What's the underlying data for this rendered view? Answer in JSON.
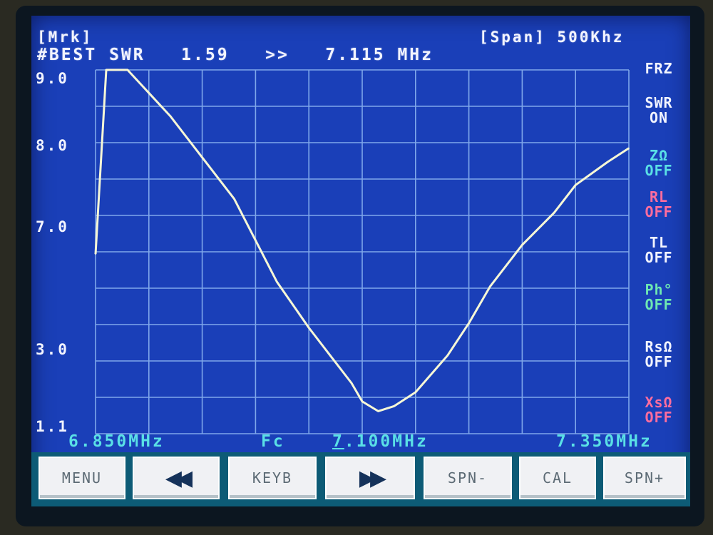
{
  "header": {
    "marker_label": "[Mrk]",
    "best_label": "#BEST SWR",
    "swr_value": "1.59",
    "arrows": ">>",
    "best_freq": "7.115 MHz",
    "span_label": "[Span] 500Khz"
  },
  "y_axis": {
    "ticks": [
      "9.0",
      "8.0",
      "7.0",
      "3.0",
      "1.1"
    ]
  },
  "side_menu": {
    "frz": "FRZ",
    "swr": [
      "SWR",
      "ON"
    ],
    "z": [
      "ZΩ",
      "OFF"
    ],
    "rl": [
      "RL",
      "OFF"
    ],
    "tl": [
      "TL",
      "OFF"
    ],
    "ph": [
      "Ph°",
      "OFF"
    ],
    "rs": [
      "RsΩ",
      "OFF"
    ],
    "xs": [
      "XsΩ",
      "OFF"
    ]
  },
  "freq_axis": {
    "start": "6.850MHz",
    "center_label": "Fc",
    "center_first_digit": "7",
    "center_rest": ".100MHz",
    "end": "7.350MHz"
  },
  "buttons": {
    "menu": "MENU",
    "back": "◀◀",
    "keyb": "KEYB",
    "fwd": "▶▶",
    "spn_minus": "SPN-",
    "cal": "CAL",
    "spn_plus": "SPN+"
  },
  "colors": {
    "screen_bg": "#1a3fb8",
    "grid": "#7fa7ea",
    "trace": "#f6f7d6",
    "cyan": "#5ae0e6",
    "magenta": "#ff6d9e",
    "green": "#6ee8b2"
  },
  "chart_data": {
    "type": "line",
    "x": [
      6.85,
      6.86,
      6.87,
      6.88,
      6.9,
      6.92,
      6.95,
      6.98,
      7.0,
      7.02,
      7.05,
      7.07,
      7.09,
      7.1,
      7.115,
      7.13,
      7.15,
      7.18,
      7.2,
      7.22,
      7.25,
      7.28,
      7.3,
      7.33,
      7.35
    ],
    "y": [
      5.0,
      9.0,
      9.0,
      9.0,
      8.5,
      8.0,
      7.1,
      6.2,
      5.3,
      4.4,
      3.4,
      2.8,
      2.2,
      1.8,
      1.59,
      1.7,
      2.0,
      2.8,
      3.5,
      4.3,
      5.2,
      5.9,
      6.5,
      7.0,
      7.3
    ]
  }
}
